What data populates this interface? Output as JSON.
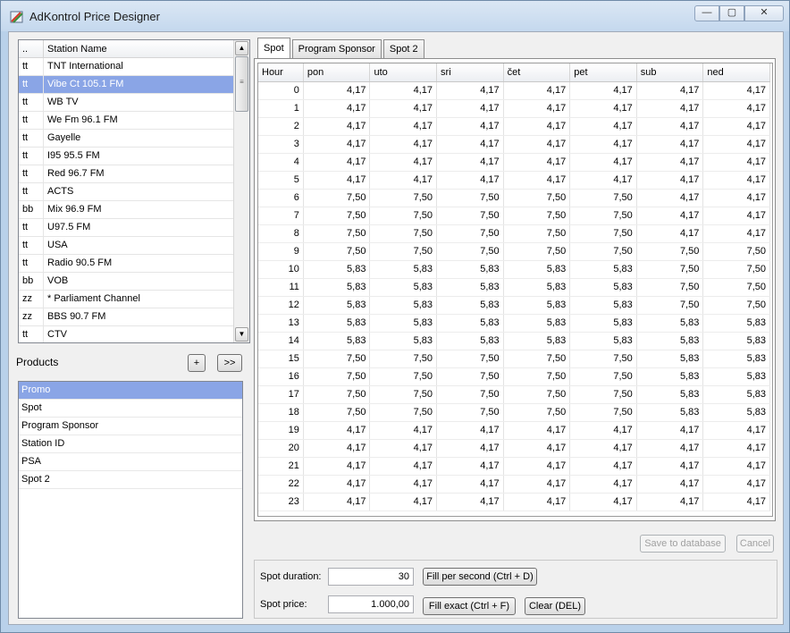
{
  "window": {
    "title": "AdKontrol Price Designer",
    "min_glyph": "—",
    "max_glyph": "▢",
    "close_glyph": "✕"
  },
  "stations": {
    "header_code": "..",
    "header_name": "Station Name",
    "scroll_up": "▲",
    "scroll_down": "▼",
    "scroll_grip": "≡",
    "items": [
      {
        "code": "tt",
        "name": "TNT International"
      },
      {
        "code": "tt",
        "name": "Vibe Ct 105.1 FM",
        "selected": true
      },
      {
        "code": "tt",
        "name": "WB TV"
      },
      {
        "code": "tt",
        "name": "We Fm 96.1 FM"
      },
      {
        "code": "tt",
        "name": "Gayelle"
      },
      {
        "code": "tt",
        "name": "I95 95.5 FM"
      },
      {
        "code": "tt",
        "name": "Red 96.7 FM"
      },
      {
        "code": "tt",
        "name": "ACTS"
      },
      {
        "code": "bb",
        "name": "Mix 96.9 FM"
      },
      {
        "code": "tt",
        "name": "U97.5 FM"
      },
      {
        "code": "tt",
        "name": "USA"
      },
      {
        "code": "tt",
        "name": "Radio 90.5 FM"
      },
      {
        "code": "bb",
        "name": "VOB"
      },
      {
        "code": "zz",
        "name": "* Parliament Channel"
      },
      {
        "code": "zz",
        "name": "BBS 90.7 FM"
      },
      {
        "code": "tt",
        "name": "CTV"
      }
    ]
  },
  "products": {
    "label": "Products",
    "add_label": "+",
    "next_label": ">>",
    "items": [
      {
        "name": "Promo",
        "selected": true
      },
      {
        "name": "Spot"
      },
      {
        "name": "Program Sponsor"
      },
      {
        "name": "Station ID"
      },
      {
        "name": "PSA"
      },
      {
        "name": "Spot 2"
      }
    ]
  },
  "tabs": [
    "Spot",
    "Program Sponsor",
    "Spot 2"
  ],
  "grid": {
    "columns": [
      "Hour",
      "pon",
      "uto",
      "sri",
      "čet",
      "pet",
      "sub",
      "ned"
    ],
    "rows": [
      [
        "0",
        "4,17",
        "4,17",
        "4,17",
        "4,17",
        "4,17",
        "4,17",
        "4,17"
      ],
      [
        "1",
        "4,17",
        "4,17",
        "4,17",
        "4,17",
        "4,17",
        "4,17",
        "4,17"
      ],
      [
        "2",
        "4,17",
        "4,17",
        "4,17",
        "4,17",
        "4,17",
        "4,17",
        "4,17"
      ],
      [
        "3",
        "4,17",
        "4,17",
        "4,17",
        "4,17",
        "4,17",
        "4,17",
        "4,17"
      ],
      [
        "4",
        "4,17",
        "4,17",
        "4,17",
        "4,17",
        "4,17",
        "4,17",
        "4,17"
      ],
      [
        "5",
        "4,17",
        "4,17",
        "4,17",
        "4,17",
        "4,17",
        "4,17",
        "4,17"
      ],
      [
        "6",
        "7,50",
        "7,50",
        "7,50",
        "7,50",
        "7,50",
        "4,17",
        "4,17"
      ],
      [
        "7",
        "7,50",
        "7,50",
        "7,50",
        "7,50",
        "7,50",
        "4,17",
        "4,17"
      ],
      [
        "8",
        "7,50",
        "7,50",
        "7,50",
        "7,50",
        "7,50",
        "4,17",
        "4,17"
      ],
      [
        "9",
        "7,50",
        "7,50",
        "7,50",
        "7,50",
        "7,50",
        "7,50",
        "7,50"
      ],
      [
        "10",
        "5,83",
        "5,83",
        "5,83",
        "5,83",
        "5,83",
        "7,50",
        "7,50"
      ],
      [
        "11",
        "5,83",
        "5,83",
        "5,83",
        "5,83",
        "5,83",
        "7,50",
        "7,50"
      ],
      [
        "12",
        "5,83",
        "5,83",
        "5,83",
        "5,83",
        "5,83",
        "7,50",
        "7,50"
      ],
      [
        "13",
        "5,83",
        "5,83",
        "5,83",
        "5,83",
        "5,83",
        "5,83",
        "5,83"
      ],
      [
        "14",
        "5,83",
        "5,83",
        "5,83",
        "5,83",
        "5,83",
        "5,83",
        "5,83"
      ],
      [
        "15",
        "7,50",
        "7,50",
        "7,50",
        "7,50",
        "7,50",
        "5,83",
        "5,83"
      ],
      [
        "16",
        "7,50",
        "7,50",
        "7,50",
        "7,50",
        "7,50",
        "5,83",
        "5,83"
      ],
      [
        "17",
        "7,50",
        "7,50",
        "7,50",
        "7,50",
        "7,50",
        "5,83",
        "5,83"
      ],
      [
        "18",
        "7,50",
        "7,50",
        "7,50",
        "7,50",
        "7,50",
        "5,83",
        "5,83"
      ],
      [
        "19",
        "4,17",
        "4,17",
        "4,17",
        "4,17",
        "4,17",
        "4,17",
        "4,17"
      ],
      [
        "20",
        "4,17",
        "4,17",
        "4,17",
        "4,17",
        "4,17",
        "4,17",
        "4,17"
      ],
      [
        "21",
        "4,17",
        "4,17",
        "4,17",
        "4,17",
        "4,17",
        "4,17",
        "4,17"
      ],
      [
        "22",
        "4,17",
        "4,17",
        "4,17",
        "4,17",
        "4,17",
        "4,17",
        "4,17"
      ],
      [
        "23",
        "4,17",
        "4,17",
        "4,17",
        "4,17",
        "4,17",
        "4,17",
        "4,17"
      ]
    ]
  },
  "actions": {
    "save_label": "Save to database",
    "cancel_label": "Cancel"
  },
  "bottom": {
    "duration_label": "Spot duration:",
    "duration_value": "30",
    "price_label": "Spot price:",
    "price_value": "1.000,00",
    "fill_per_second": "Fill per second (Ctrl + D)",
    "fill_exact": "Fill exact (Ctrl + F)",
    "clear": "Clear (DEL)"
  }
}
